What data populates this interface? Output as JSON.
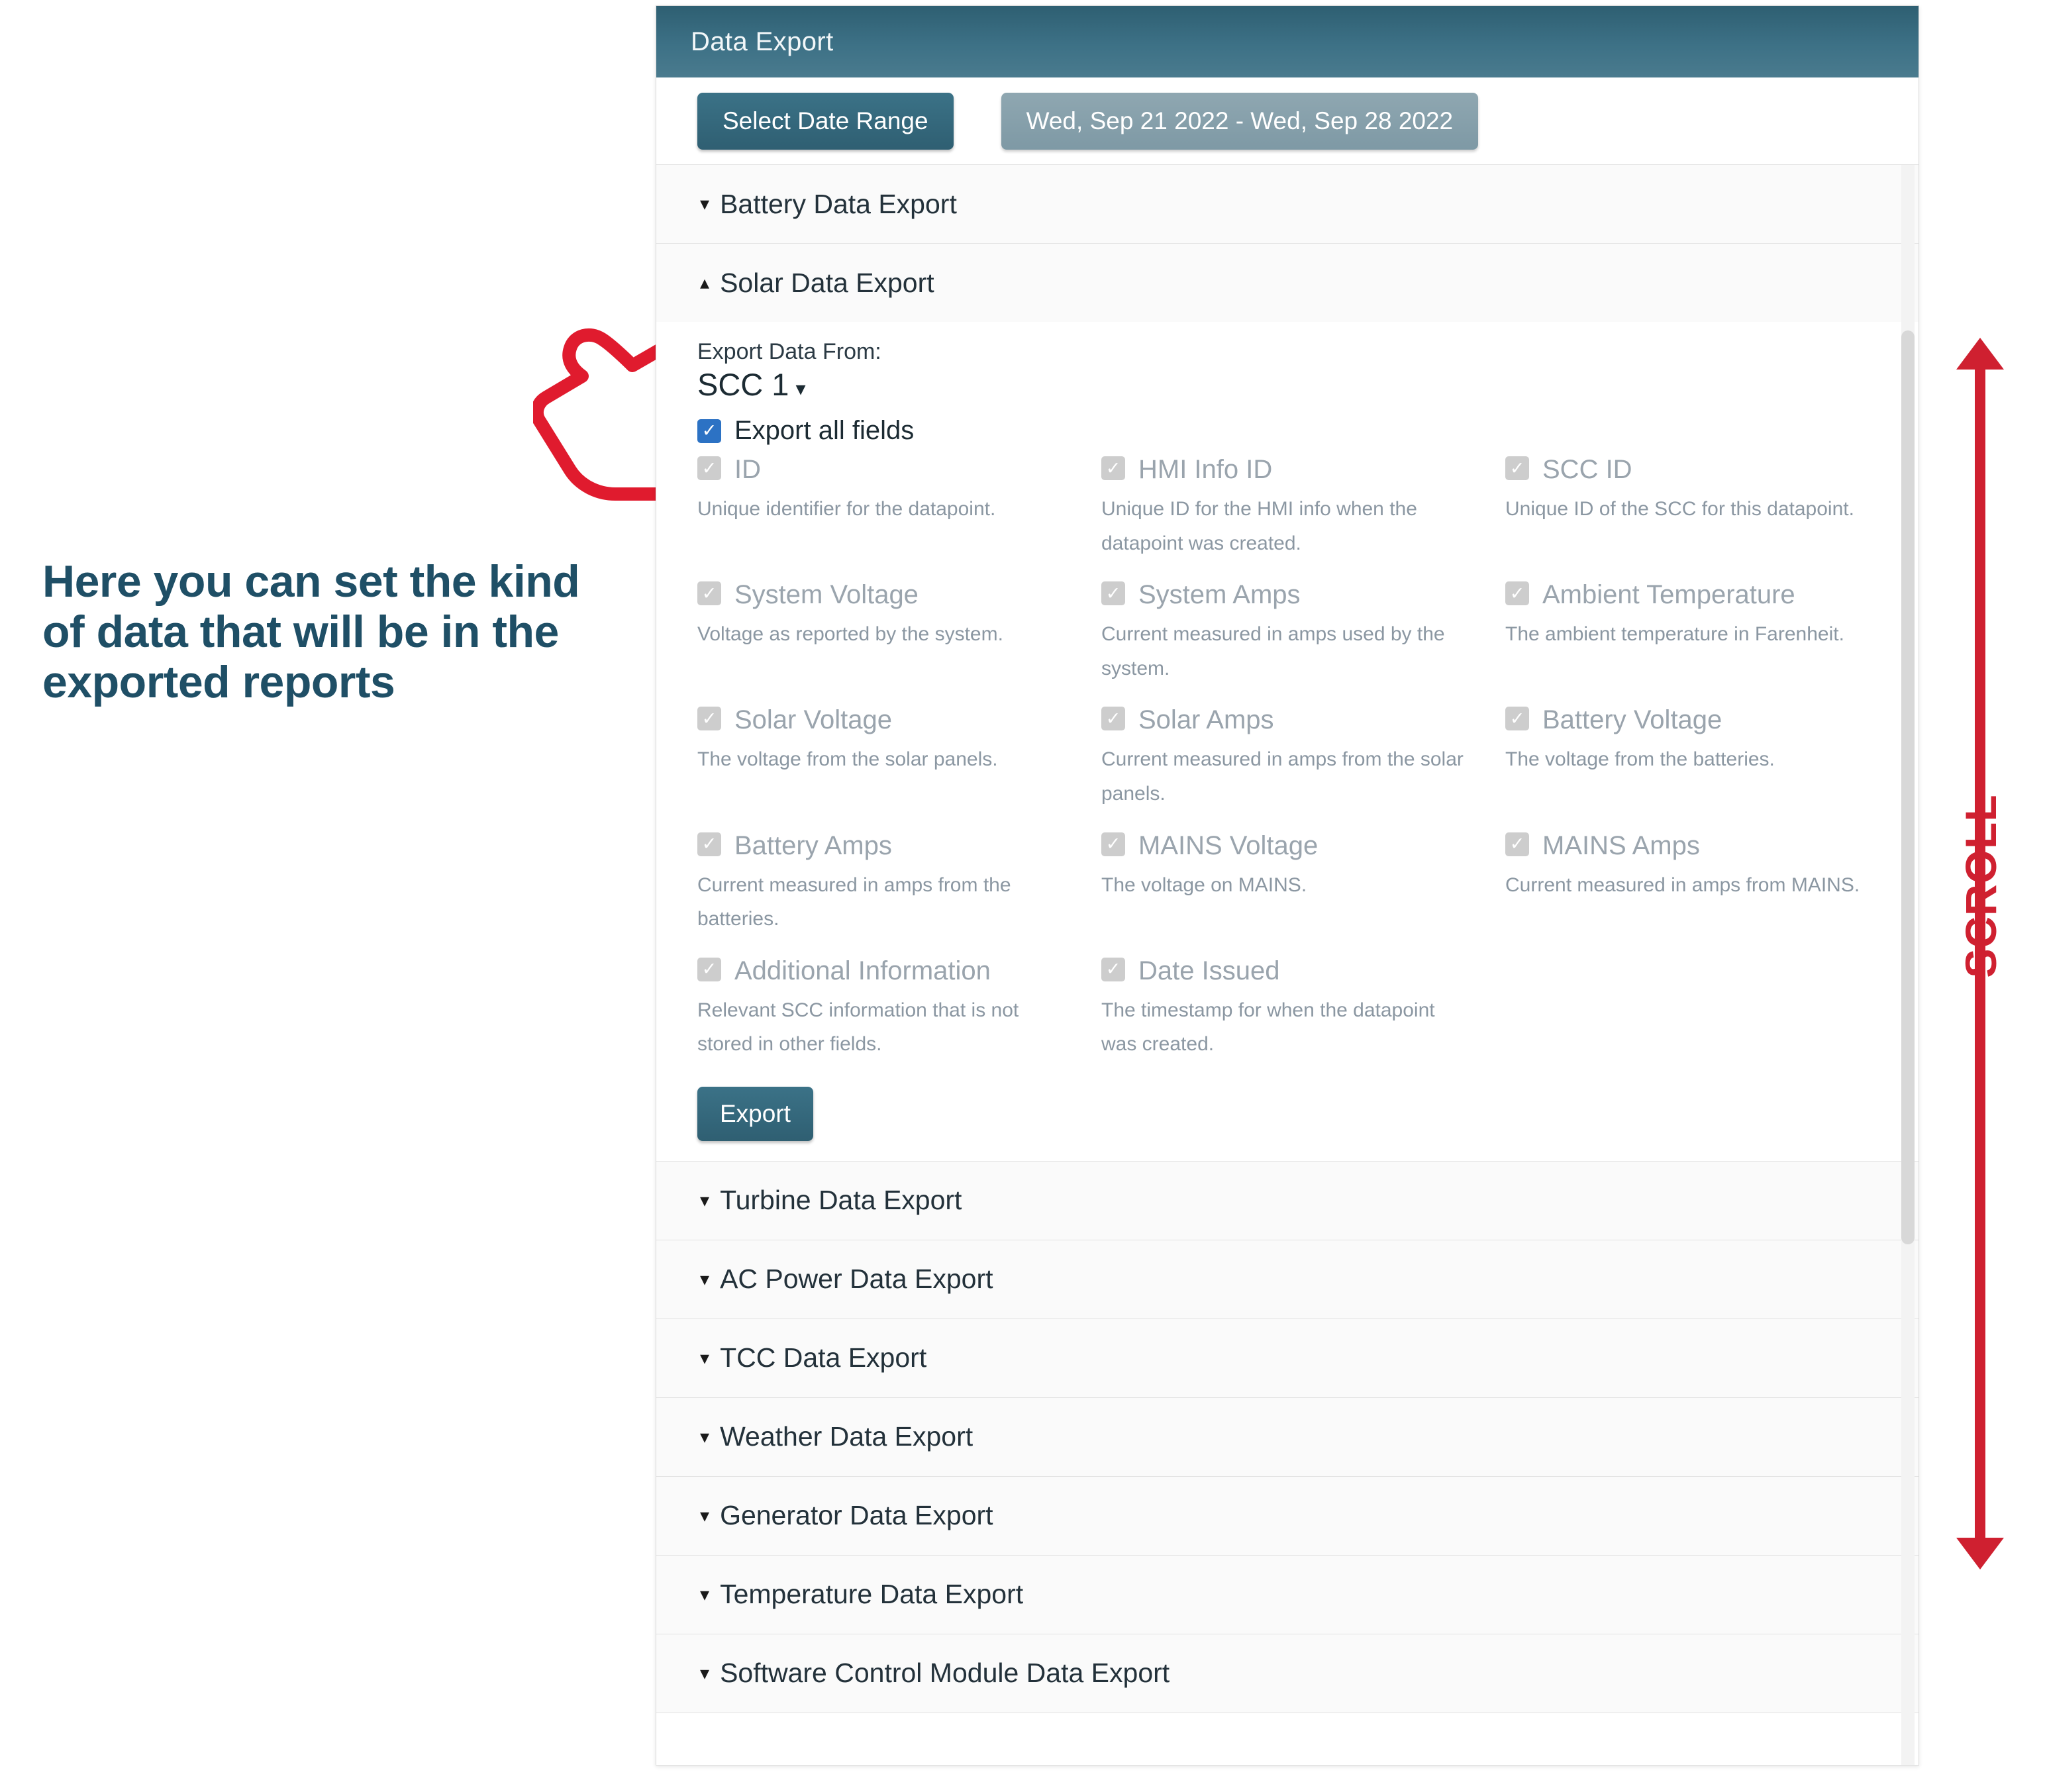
{
  "annotation": {
    "note_text": "Here you can set the kind of data that will be in the exported reports",
    "scroll_label": "SCROLL",
    "note_color": "#1f4f66",
    "scroll_color": "#cf2030",
    "cursor_icon": "pointing-hand-icon"
  },
  "panel": {
    "title": "Data Export",
    "header_color": "#3d7186"
  },
  "toolbar": {
    "select_date_range_label": "Select Date Range",
    "date_range_value": "Wed, Sep 21 2022 - Wed, Sep 28 2022"
  },
  "accordion": {
    "items": [
      {
        "label": "Battery Data Export",
        "expanded": false,
        "caret": "▾"
      },
      {
        "label": "Solar Data Export",
        "expanded": true,
        "caret": "▴"
      },
      {
        "label": "Turbine Data Export",
        "expanded": false,
        "caret": "▾"
      },
      {
        "label": "AC Power Data Export",
        "expanded": false,
        "caret": "▾"
      },
      {
        "label": "TCC Data Export",
        "expanded": false,
        "caret": "▾"
      },
      {
        "label": "Weather Data Export",
        "expanded": false,
        "caret": "▾"
      },
      {
        "label": "Generator Data Export",
        "expanded": false,
        "caret": "▾"
      },
      {
        "label": "Temperature Data Export",
        "expanded": false,
        "caret": "▾"
      },
      {
        "label": "Software Control Module Data Export",
        "expanded": false,
        "caret": "▾"
      }
    ]
  },
  "solar_panel": {
    "export_from_label": "Export Data From:",
    "export_from_value": "SCC 1",
    "export_from_caret": "▾",
    "all_fields_label": "Export all fields",
    "all_fields_checked": true,
    "export_button_label": "Export",
    "fields": [
      {
        "label": "ID",
        "desc": "Unique identifier for the datapoint.",
        "checked": true,
        "disabled": true
      },
      {
        "label": "HMI Info ID",
        "desc": "Unique ID for the HMI info when the datapoint was created.",
        "checked": true,
        "disabled": true
      },
      {
        "label": "SCC ID",
        "desc": "Unique ID of the SCC for this datapoint.",
        "checked": true,
        "disabled": true
      },
      {
        "label": "System Voltage",
        "desc": "Voltage as reported by the system.",
        "checked": true,
        "disabled": true
      },
      {
        "label": "System Amps",
        "desc": "Current measured in amps used by the system.",
        "checked": true,
        "disabled": true
      },
      {
        "label": "Ambient Temperature",
        "desc": "The ambient temperature in Farenheit.",
        "checked": true,
        "disabled": true
      },
      {
        "label": "Solar Voltage",
        "desc": "The voltage from the solar panels.",
        "checked": true,
        "disabled": true
      },
      {
        "label": "Solar Amps",
        "desc": "Current measured in amps from the solar panels.",
        "checked": true,
        "disabled": true
      },
      {
        "label": "Battery Voltage",
        "desc": "The voltage from the batteries.",
        "checked": true,
        "disabled": true
      },
      {
        "label": "Battery Amps",
        "desc": "Current measured in amps from the batteries.",
        "checked": true,
        "disabled": true
      },
      {
        "label": "MAINS Voltage",
        "desc": "The voltage on MAINS.",
        "checked": true,
        "disabled": true
      },
      {
        "label": "MAINS Amps",
        "desc": "Current measured in amps from MAINS.",
        "checked": true,
        "disabled": true
      },
      {
        "label": "Additional Information",
        "desc": "Relevant SCC information that is not stored in other fields.",
        "checked": true,
        "disabled": true
      },
      {
        "label": "Date Issued",
        "desc": "The timestamp for when the datapoint was created.",
        "checked": true,
        "disabled": true
      }
    ]
  }
}
